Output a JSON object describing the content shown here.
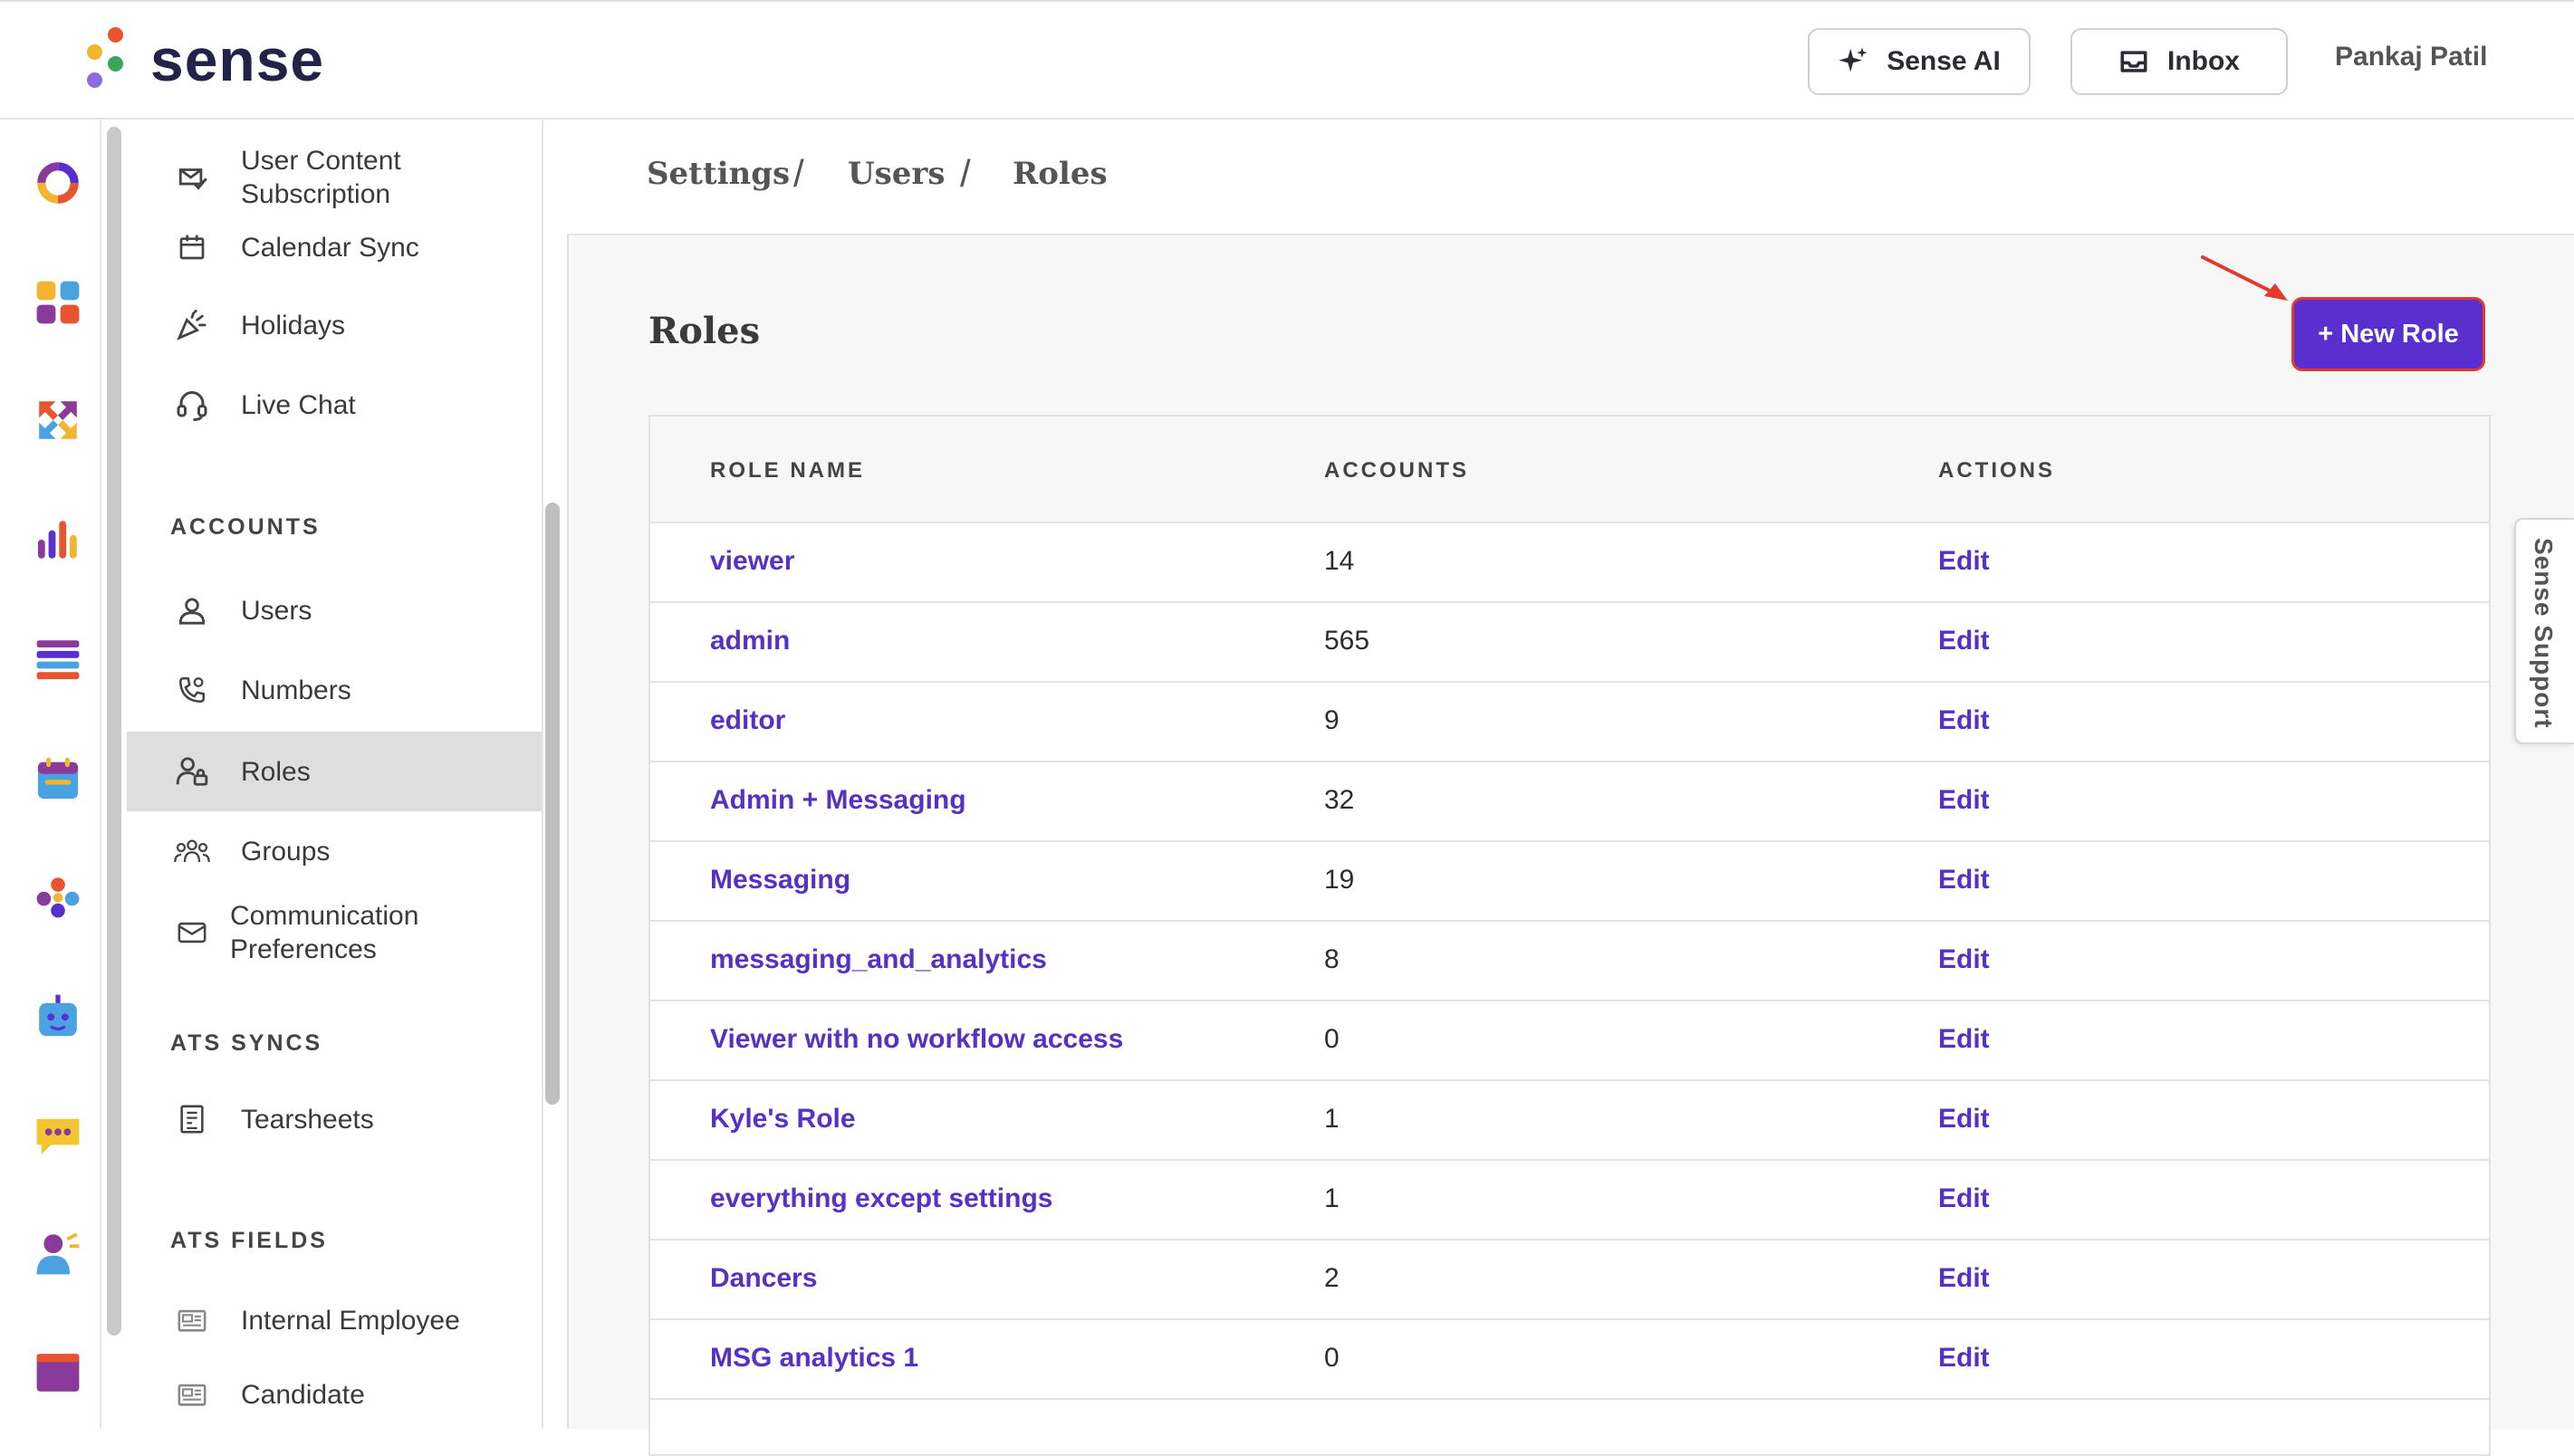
{
  "brand": {
    "name": "sense"
  },
  "topbar": {
    "sense_ai_label": "Sense AI",
    "inbox_label": "Inbox",
    "user_name": "Pankaj Patil"
  },
  "rail": {
    "icons": [
      "dashboard-ring-icon",
      "apps-grid-icon",
      "arrows-exchange-icon",
      "bar-chart-icon",
      "list-icon",
      "calendar-icon",
      "people-network-icon",
      "chatbot-icon",
      "chat-bubble-icon",
      "contact-person-icon",
      "browser-window-icon"
    ]
  },
  "sidebar": {
    "items_top": [
      {
        "label": "User Content\nSubscription",
        "icon": "mail-check-icon"
      },
      {
        "label": "Calendar Sync",
        "icon": "calendar-icon"
      },
      {
        "label": "Holidays",
        "icon": "party-popper-icon"
      },
      {
        "label": "Live Chat",
        "icon": "headset-icon"
      }
    ],
    "accounts_heading": "ACCOUNTS",
    "accounts_items": [
      {
        "label": "Users",
        "icon": "user-icon"
      },
      {
        "label": "Numbers",
        "icon": "phone-icon"
      },
      {
        "label": "Roles",
        "icon": "user-lock-icon",
        "active": true
      },
      {
        "label": "Groups",
        "icon": "group-icon"
      },
      {
        "label": "Communication\nPreferences",
        "icon": "envelope-icon"
      }
    ],
    "ats_syncs_heading": "ATS SYNCS",
    "ats_syncs_items": [
      {
        "label": "Tearsheets",
        "icon": "tearsheet-icon"
      }
    ],
    "ats_fields_heading": "ATS FIELDS",
    "ats_fields_items": [
      {
        "label": "Internal Employee",
        "icon": "field-card-icon"
      },
      {
        "label": "Candidate",
        "icon": "field-card-icon"
      }
    ]
  },
  "breadcrumb": [
    "Settings",
    "Users",
    "Roles"
  ],
  "main": {
    "title": "Roles",
    "new_role_label": "+ New Role"
  },
  "table": {
    "headers": [
      "ROLE NAME",
      "ACCOUNTS",
      "ACTIONS"
    ],
    "rows": [
      {
        "name": "viewer",
        "accounts": "14",
        "action": "Edit"
      },
      {
        "name": "admin",
        "accounts": "565",
        "action": "Edit"
      },
      {
        "name": "editor",
        "accounts": "9",
        "action": "Edit"
      },
      {
        "name": "Admin + Messaging",
        "accounts": "32",
        "action": "Edit"
      },
      {
        "name": "Messaging",
        "accounts": "19",
        "action": "Edit"
      },
      {
        "name": "messaging_and_analytics",
        "accounts": "8",
        "action": "Edit"
      },
      {
        "name": "Viewer with no workflow access",
        "accounts": "0",
        "action": "Edit"
      },
      {
        "name": "Kyle's Role",
        "accounts": "1",
        "action": "Edit"
      },
      {
        "name": "everything except settings",
        "accounts": "1",
        "action": "Edit"
      },
      {
        "name": "Dancers",
        "accounts": "2",
        "action": "Edit"
      },
      {
        "name": "MSG analytics 1",
        "accounts": "0",
        "action": "Edit"
      }
    ]
  },
  "support_tab": {
    "label": "Sense Support"
  },
  "colors": {
    "accent": "#5a2fd0",
    "link": "#5532c4",
    "highlight_border": "#e23a2c"
  }
}
